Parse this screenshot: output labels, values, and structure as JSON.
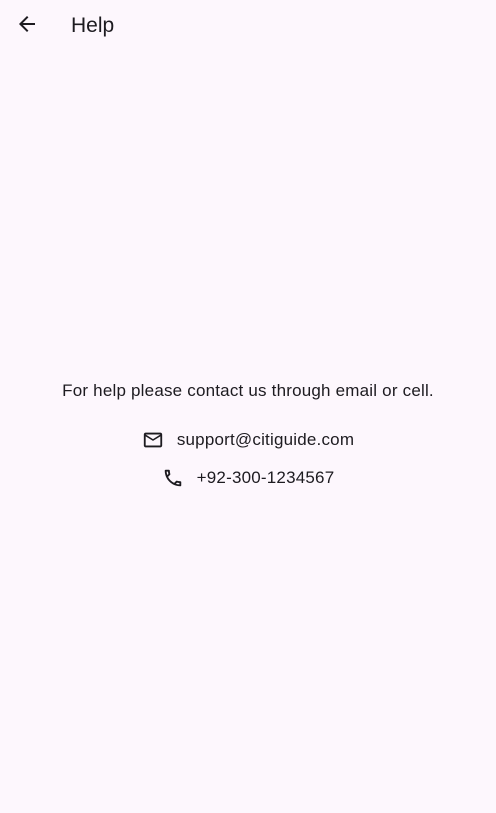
{
  "app_bar": {
    "back_icon": "arrow-back-icon",
    "title": "Help"
  },
  "help": {
    "message": "For help please contact us through email or cell.",
    "email": {
      "icon": "mail-icon",
      "value": "support@citiguide.com"
    },
    "phone": {
      "icon": "phone-icon",
      "value": "+92-300-1234567"
    }
  },
  "colors": {
    "background": "#fdf7fd",
    "text": "#1d1b20"
  }
}
